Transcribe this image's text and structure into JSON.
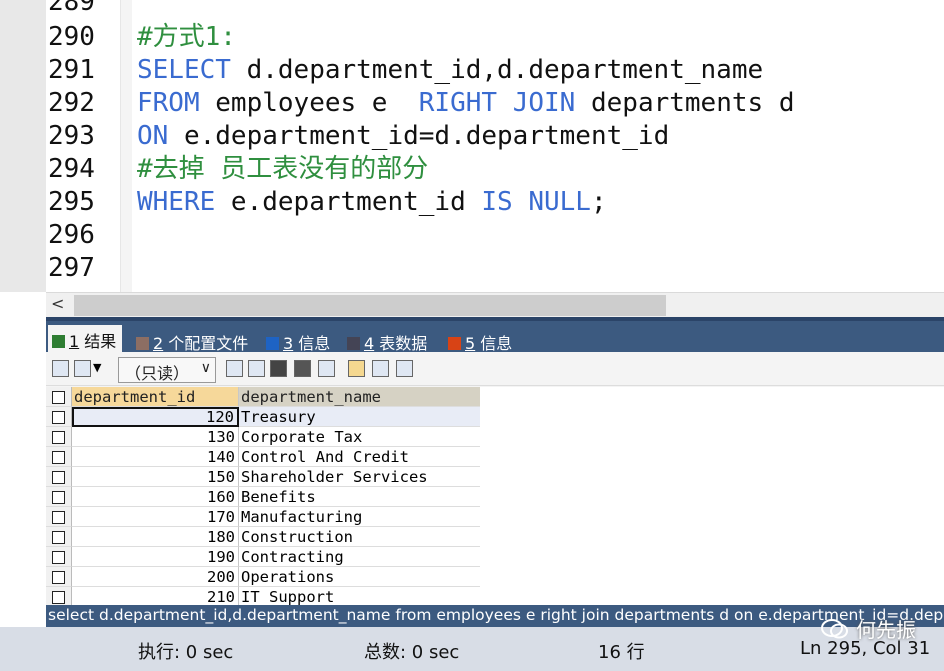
{
  "editor": {
    "partial_line_number": "289",
    "lines": [
      {
        "num": "290",
        "parts": [
          {
            "t": "#方式1:",
            "c": "cm"
          }
        ]
      },
      {
        "num": "291",
        "parts": [
          {
            "t": "SELECT",
            "c": "kw"
          },
          {
            "t": " d.department_id,d.department_name",
            "c": ""
          }
        ]
      },
      {
        "num": "292",
        "parts": [
          {
            "t": "FROM",
            "c": "kw"
          },
          {
            "t": " employees e  ",
            "c": ""
          },
          {
            "t": "RIGHT JOIN",
            "c": "kw"
          },
          {
            "t": " departments d",
            "c": ""
          }
        ]
      },
      {
        "num": "293",
        "parts": [
          {
            "t": "ON",
            "c": "kw"
          },
          {
            "t": " e.department_id=d.department_id",
            "c": ""
          }
        ]
      },
      {
        "num": "294",
        "parts": [
          {
            "t": "#去掉 员工表没有的部分",
            "c": "cm"
          }
        ]
      },
      {
        "num": "295",
        "parts": [
          {
            "t": "WHERE",
            "c": "kw"
          },
          {
            "t": " e.department_id ",
            "c": ""
          },
          {
            "t": "IS NULL",
            "c": "kw"
          },
          {
            "t": ";",
            "c": ""
          }
        ]
      },
      {
        "num": "296",
        "parts": []
      },
      {
        "num": "297",
        "parts": []
      }
    ],
    "scroll_left_arrow": "<"
  },
  "tabs": [
    {
      "num": "1",
      "label": "结果",
      "icon": "grid-icon",
      "active": true
    },
    {
      "num": "2",
      "label": "个配置文件",
      "icon": "profile-icon",
      "active": false
    },
    {
      "num": "3",
      "label": "信息",
      "icon": "info-icon",
      "active": false
    },
    {
      "num": "4",
      "label": "表数据",
      "icon": "table-icon",
      "active": false
    },
    {
      "num": "5",
      "label": "信息",
      "icon": "history-icon",
      "active": false
    }
  ],
  "toolbar": {
    "readonly_label": "（只读）",
    "dropdown_arrow": "∨"
  },
  "grid": {
    "columns": [
      "department_id",
      "department_name"
    ],
    "rows": [
      {
        "id": "120",
        "name": "Treasury"
      },
      {
        "id": "130",
        "name": "Corporate Tax"
      },
      {
        "id": "140",
        "name": "Control And Credit"
      },
      {
        "id": "150",
        "name": "Shareholder Services"
      },
      {
        "id": "160",
        "name": "Benefits"
      },
      {
        "id": "170",
        "name": "Manufacturing"
      },
      {
        "id": "180",
        "name": "Construction"
      },
      {
        "id": "190",
        "name": "Contracting"
      },
      {
        "id": "200",
        "name": "Operations"
      },
      {
        "id": "210",
        "name": "IT Support"
      }
    ]
  },
  "sql_bar": "select d.department_id,d.department_name from employees e right join departments d on e.department_id=d.department_id",
  "status": {
    "exec": "执行: 0 sec",
    "total": "总数: 0 sec",
    "rows": "16 行",
    "position": "Ln 295, Col 31"
  },
  "watermark": "何先振"
}
